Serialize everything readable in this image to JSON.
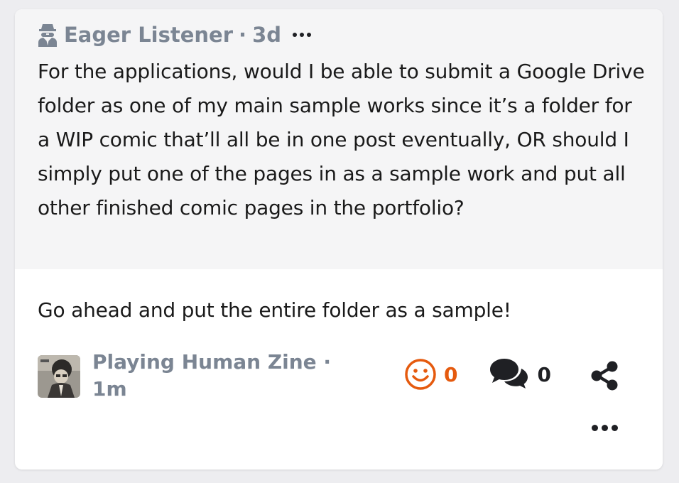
{
  "question": {
    "asker_name": "Eager Listener",
    "separator": "·",
    "time": "3d",
    "text": "For the applications, would I be able to submit a Google Drive folder as one of my main sample works since it’s a folder for a WIP comic that’ll all be in one post eventually, OR should I simply put one of the pages in as a sample work and put all other finished comic pages in the portfolio?"
  },
  "answer": {
    "text": "Go ahead and put the entire folder as a sample!",
    "responder_name": "Playing Human Zine",
    "separator": "·",
    "time": "1m",
    "reaction_count": "0",
    "comment_count": "0"
  },
  "icons": {
    "asker": "spy-icon",
    "more_question": "more-icon",
    "reaction": "smile-icon",
    "comments": "comments-icon",
    "share": "share-icon",
    "more_answer": "more-icon"
  },
  "colors": {
    "accent": "#e55a0e",
    "muted_text": "#7b8593",
    "question_bg": "#f5f5f6"
  }
}
